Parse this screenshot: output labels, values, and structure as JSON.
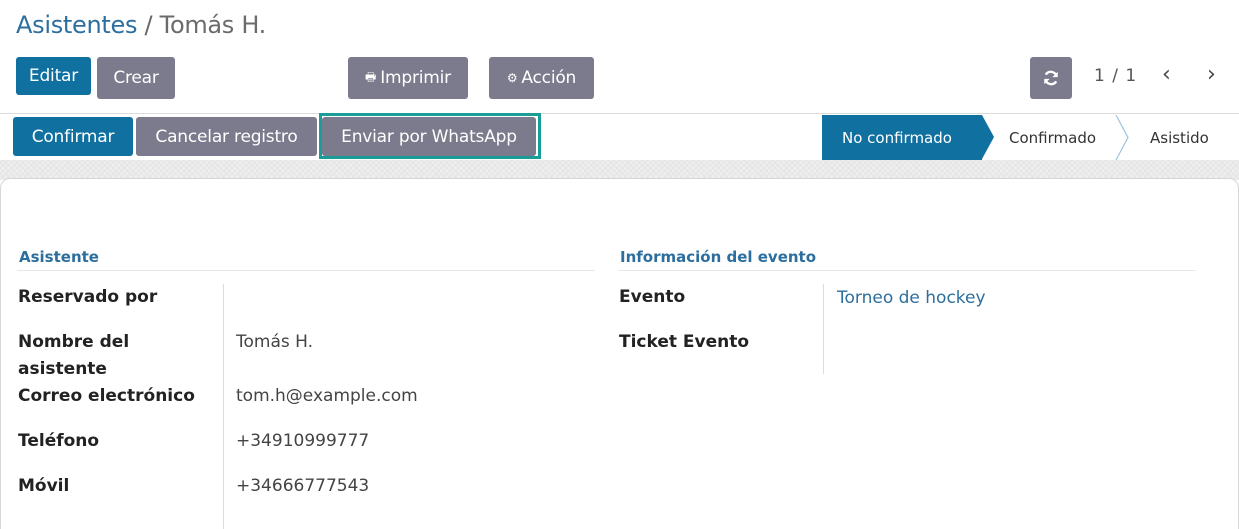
{
  "breadcrumb": {
    "parent": "Asistentes",
    "separator": "/",
    "current": "Tomás H."
  },
  "toolbar": {
    "edit_label": "Editar",
    "create_label": "Crear",
    "print_label": "Imprimir",
    "action_label": "Acción",
    "print_icon": "printer-icon",
    "action_icon": "gear-icon",
    "refresh_icon": "refresh-icon",
    "pager": "1 / 1",
    "prev": "‹",
    "next": "›"
  },
  "actions": {
    "confirm_label": "Confirmar",
    "cancel_label": "Cancelar registro",
    "whatsapp_label": "Enviar por WhatsApp"
  },
  "status": {
    "stages": [
      "No confirmado",
      "Confirmado",
      "Asistido"
    ],
    "active": "No confirmado"
  },
  "attendee": {
    "title": "Asistente",
    "fields": [
      {
        "label": "Reservado por",
        "value": ""
      },
      {
        "label": "Nombre del asistente",
        "value": "Tomás H."
      },
      {
        "label": "Correo electrónico",
        "value": "tom.h@example.com"
      },
      {
        "label": "Teléfono",
        "value": "+34910999777"
      },
      {
        "label": "Móvil",
        "value": "+34666777543"
      }
    ]
  },
  "event_info": {
    "title": "Información del evento",
    "fields": [
      {
        "label": "Evento",
        "value": "Torneo de hockey"
      },
      {
        "label": "Ticket Evento",
        "value": ""
      }
    ]
  },
  "colors": {
    "primary": "#10709f",
    "secondary": "#7b7b8d",
    "link": "#2c6e9e",
    "highlight": "#1a9d96"
  }
}
